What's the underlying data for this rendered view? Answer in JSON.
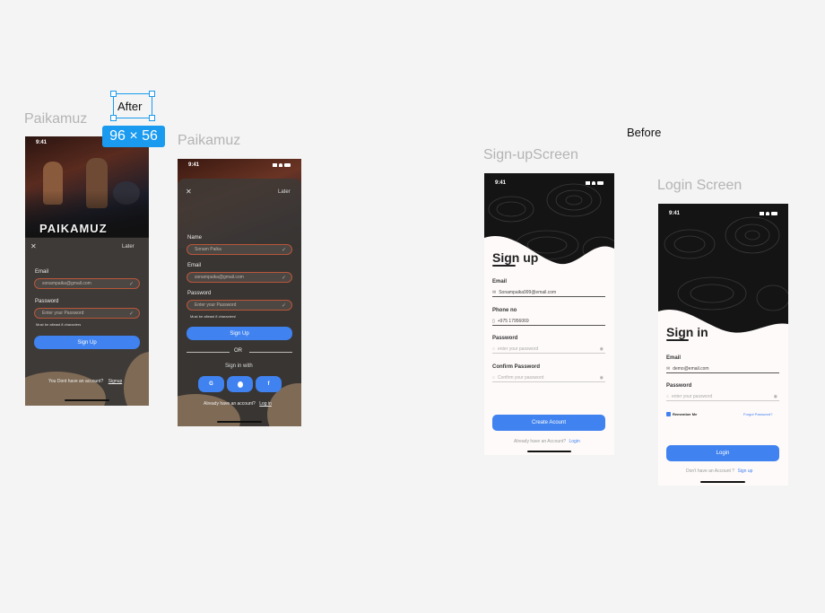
{
  "frames": {
    "after_label": "Paikamuz",
    "after2_label": "Paikamuz",
    "signup_label": "Sign-upScreen",
    "login_label": "Login Screen",
    "before_label": "Before"
  },
  "selection": {
    "label": "After",
    "size_badge": "96 × 56"
  },
  "phone1": {
    "time": "9:41",
    "logo": "PAIKAMUZ",
    "close": "✕",
    "later": "Later",
    "email_label": "Email",
    "email_value": "sonampaika@gmail.com",
    "password_label": "Password",
    "password_placeholder": "Enter your Password",
    "password_hint": "Must be atleast 8 characters",
    "button": "Sign Up",
    "footer_text": "You Dont have an account?",
    "footer_link": "Signup"
  },
  "phone2": {
    "time": "9:41",
    "close": "✕",
    "later": "Later",
    "name_label": "Name",
    "name_value": "Sonam Paika",
    "email_label": "Email",
    "email_value": "sonampaika@gmail.com",
    "password_label": "Password",
    "password_placeholder": "Enter your Password",
    "password_hint": "Must be atleast 8 characters!",
    "button": "Sign Up",
    "or": "OR",
    "sign_in_with": "Sign in with",
    "social": [
      "G",
      "",
      "f"
    ],
    "footer_text": "Already have an account?",
    "footer_link": "Log in"
  },
  "signup": {
    "time": "9:41",
    "title": "Sign up",
    "email_label": "Email",
    "email_value": "Sonampaika999@email.com",
    "phone_label": "Phone no",
    "phone_value": "+975 17956069",
    "password_label": "Password",
    "password_placeholder": "enter your password",
    "confirm_label": "Confirm Password",
    "confirm_placeholder": "Confirm your password",
    "button": "Create Acount",
    "footer_text": "Already have an Account?",
    "footer_link": "Login"
  },
  "login": {
    "time": "9:41",
    "title": "Sign in",
    "email_label": "Email",
    "email_value": "demo@email.com",
    "password_label": "Password",
    "password_placeholder": "enter your password",
    "remember": "Remember Me",
    "forgot": "Forgot Password?",
    "button": "Login",
    "footer_text": "Don't have an Account ?",
    "footer_link": "Sign up"
  },
  "colors": {
    "accent": "#3f82f0",
    "dark_panel": "#3e3a37",
    "field_border": "#b8563a",
    "brown": "#7f6a55",
    "selection": "#1a9bf0"
  },
  "icons": [
    "close-icon",
    "check-icon",
    "mail-icon",
    "phone-icon",
    "lock-icon",
    "eye-icon",
    "google-icon",
    "apple-icon",
    "facebook-icon",
    "wifi-icon",
    "battery-icon",
    "signal-icon"
  ]
}
